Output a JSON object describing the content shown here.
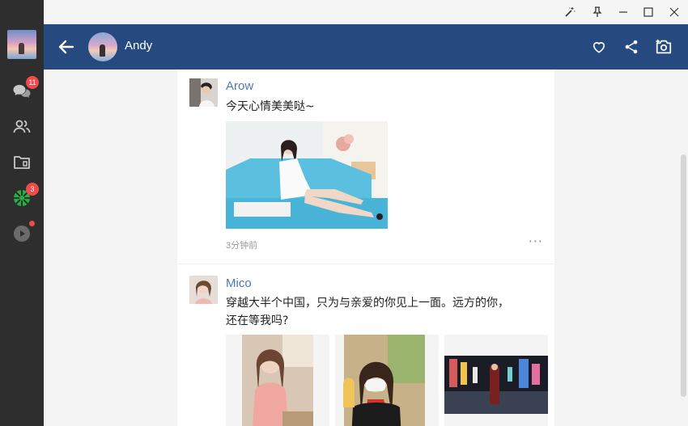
{
  "window": {
    "controls": [
      "magic-wand-icon",
      "pin-icon",
      "minimize-icon",
      "maximize-icon",
      "close-icon"
    ]
  },
  "sidebar": {
    "items": [
      {
        "icon": "chat-icon",
        "badge": "11"
      },
      {
        "icon": "contacts-icon",
        "badge": ""
      },
      {
        "icon": "folder-icon",
        "badge": ""
      },
      {
        "icon": "moments-icon",
        "badge": "3"
      },
      {
        "icon": "video-icon",
        "badge": ""
      }
    ]
  },
  "header": {
    "name": "Andy",
    "actions": [
      "heart-icon",
      "share-icon",
      "camera-icon"
    ]
  },
  "posts": [
    {
      "author": "Arow",
      "text": "今天心情美美哒~",
      "time": "3分钟前",
      "more": "···"
    },
    {
      "author": "Mico",
      "text_line1": "穿越大半个中国，只为与亲爱的你见上一面。远方的你，",
      "text_line2": "还在等我吗?"
    }
  ],
  "colors": {
    "header_bg": "#264a80",
    "sidebar_bg": "#2e2e2e",
    "name_link": "#4e79b0",
    "badge": "#f04b4b",
    "moments_green": "#2bab43"
  }
}
